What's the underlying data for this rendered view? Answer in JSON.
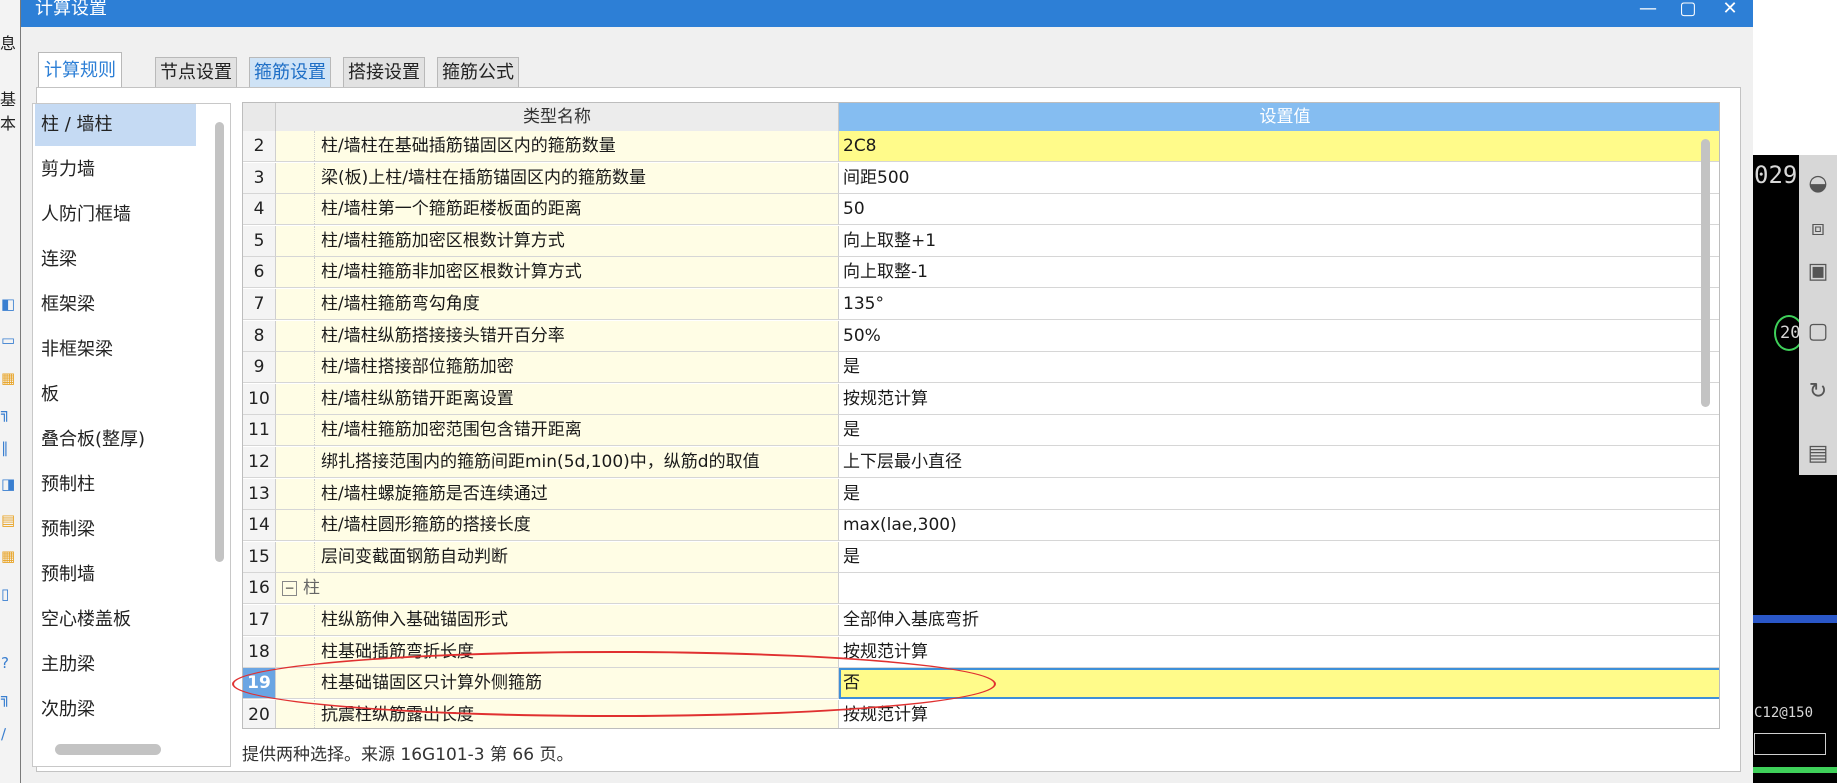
{
  "app": {
    "strip_texts": [
      "息",
      "基本"
    ],
    "dialog_title": "计算设置",
    "window_buttons": {
      "minimize": "—",
      "maximize": "▢",
      "close": "✕"
    }
  },
  "tabs": [
    {
      "label": "计算规则",
      "state": "active"
    },
    {
      "label": "节点设置",
      "state": "normal"
    },
    {
      "label": "箍筋设置",
      "state": "highlight"
    },
    {
      "label": "搭接设置",
      "state": "normal"
    },
    {
      "label": "箍筋公式",
      "state": "normal"
    }
  ],
  "categories": [
    {
      "label": "柱 / 墙柱",
      "selected": true
    },
    {
      "label": "剪力墙"
    },
    {
      "label": "人防门框墙"
    },
    {
      "label": "连梁"
    },
    {
      "label": "框架梁"
    },
    {
      "label": "非框架梁"
    },
    {
      "label": "板"
    },
    {
      "label": "叠合板(整厚)"
    },
    {
      "label": "预制柱"
    },
    {
      "label": "预制梁"
    },
    {
      "label": "预制墙"
    },
    {
      "label": "空心楼盖板"
    },
    {
      "label": "主肋梁"
    },
    {
      "label": "次肋梁"
    }
  ],
  "grid": {
    "headers": {
      "name": "类型名称",
      "value": "设置值"
    },
    "rows": [
      {
        "num": "2",
        "name": "柱/墙柱在基础插筋锚固区内的箍筋数量",
        "value": "2C8",
        "value_hl": true
      },
      {
        "num": "3",
        "name": "梁(板)上柱/墙柱在插筋锚固区内的箍筋数量",
        "value": "间距500"
      },
      {
        "num": "4",
        "name": "柱/墙柱第一个箍筋距楼板面的距离",
        "value": "50"
      },
      {
        "num": "5",
        "name": "柱/墙柱箍筋加密区根数计算方式",
        "value": "向上取整+1"
      },
      {
        "num": "6",
        "name": "柱/墙柱箍筋非加密区根数计算方式",
        "value": "向上取整-1"
      },
      {
        "num": "7",
        "name": "柱/墙柱箍筋弯勾角度",
        "value": "135°"
      },
      {
        "num": "8",
        "name": "柱/墙柱纵筋搭接接头错开百分率",
        "value": "50%"
      },
      {
        "num": "9",
        "name": "柱/墙柱搭接部位箍筋加密",
        "value": "是"
      },
      {
        "num": "10",
        "name": "柱/墙柱纵筋错开距离设置",
        "value": "按规范计算"
      },
      {
        "num": "11",
        "name": "柱/墙柱箍筋加密范围包含错开距离",
        "value": "是"
      },
      {
        "num": "12",
        "name": "绑扎搭接范围内的箍筋间距min(5d,100)中，纵筋d的取值",
        "value": "上下层最小直径"
      },
      {
        "num": "13",
        "name": "柱/墙柱螺旋箍筋是否连续通过",
        "value": "是"
      },
      {
        "num": "14",
        "name": "柱/墙柱圆形箍筋的搭接长度",
        "value": "max(lae,300)"
      },
      {
        "num": "15",
        "name": "层间变截面钢筋自动判断",
        "value": "是"
      },
      {
        "num": "16",
        "name": "柱",
        "value": "",
        "group": true
      },
      {
        "num": "17",
        "name": "柱纵筋伸入基础锚固形式",
        "value": "全部伸入基底弯折"
      },
      {
        "num": "18",
        "name": "柱基础插筋弯折长度",
        "value": "按规范计算"
      },
      {
        "num": "19",
        "name": "柱基础锚固区只计算外侧箍筋",
        "value": "否",
        "selected": true
      },
      {
        "num": "20",
        "name": "抗震柱纵筋露出长度",
        "value": "按规范计算"
      }
    ]
  },
  "status": "提供两种选择。来源 16G101-3 第 66 页。",
  "cad": {
    "label_top": "029",
    "label_mid": "20",
    "label_bottom": "C12@150",
    "tool_3d": "3D"
  },
  "colors": {
    "titlebar": "#2d7fd6",
    "header_value": "#85bdf1",
    "value_highlight": "#fffb8a",
    "annotation_red": "#e03030",
    "name_cell": "#fffde5"
  },
  "icons": [
    "orbit-icon",
    "cube-3d-icon",
    "cube-icon",
    "box-view-icon",
    "rotate-icon",
    "grid-view-icon",
    "collapse-minus-icon"
  ]
}
